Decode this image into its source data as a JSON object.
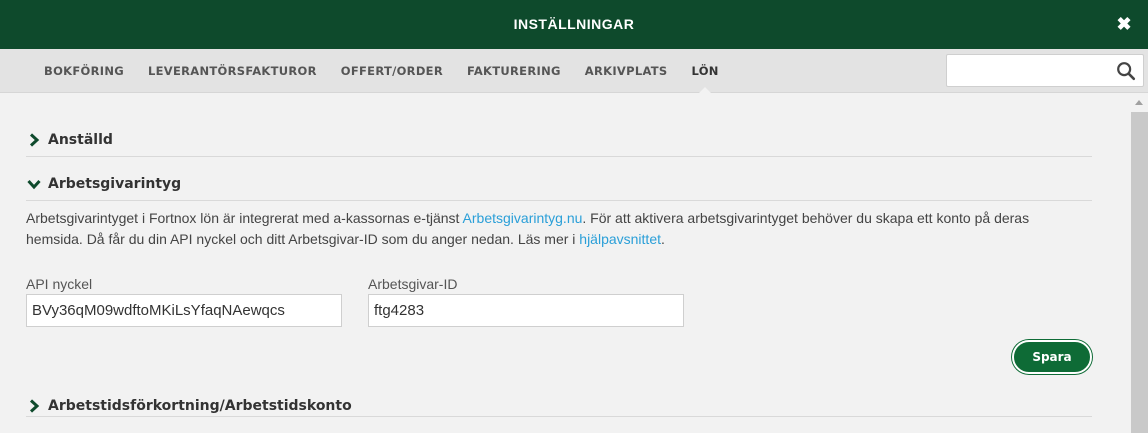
{
  "header": {
    "title": "INSTÄLLNINGAR",
    "close_glyph": "✖"
  },
  "tabs": [
    {
      "label": "BOKFÖRING",
      "active": false
    },
    {
      "label": "LEVERANTÖRSFAKTUROR",
      "active": false
    },
    {
      "label": "OFFERT/ORDER",
      "active": false
    },
    {
      "label": "FAKTURERING",
      "active": false
    },
    {
      "label": "ARKIVPLATS",
      "active": false
    },
    {
      "label": "LÖN",
      "active": true
    }
  ],
  "search": {
    "value": "",
    "placeholder": "",
    "icon": "search-icon"
  },
  "sections": {
    "anstalld": {
      "title": "Anställd",
      "expanded": false
    },
    "arbetsgivarintyg": {
      "title": "Arbetsgivarintyg",
      "expanded": true,
      "desc_part1": "Arbetsgivarintyget i Fortnox lön är integrerat med a-kassornas e-tjänst ",
      "desc_link1": "Arbetsgivarintyg.nu",
      "desc_part2": ". För att aktivera arbetsgivarintyget behöver du skapa ett konto på deras hemsida. Då får du din API nyckel och ditt Arbetsgivar-ID som du anger nedan. Läs mer i ",
      "desc_link2": "hjälpavsnittet",
      "desc_part3": ".",
      "api_label": "API nyckel",
      "api_value": "BVy36qM09wdftoMKiLsYfaqNAewqcs",
      "id_label": "Arbetsgivar-ID",
      "id_value": "ftg4283",
      "save_label": "Spara"
    },
    "arbetstid": {
      "title": "Arbetstidsförkortning/Arbetstidskonto",
      "expanded": false
    }
  },
  "colors": {
    "brand": "#0e4a2c",
    "button": "#0e6b36",
    "link": "#2a9fd8"
  }
}
